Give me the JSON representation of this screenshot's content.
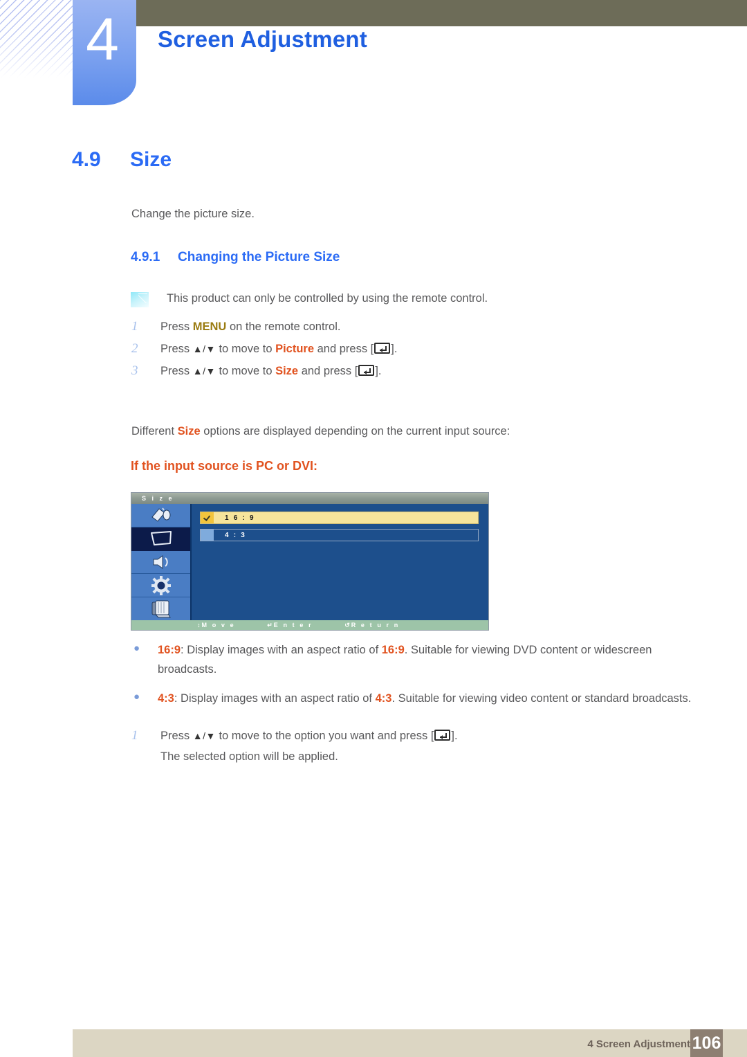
{
  "header": {
    "chapter_number": "4",
    "chapter_title": "Screen Adjustment"
  },
  "section": {
    "number": "4.9",
    "title": "Size",
    "intro": "Change the picture size."
  },
  "subsection": {
    "number": "4.9.1",
    "title": "Changing the Picture Size",
    "note": "This product can only be controlled by using the remote control.",
    "note_icon": "note-icon"
  },
  "steps": [
    {
      "n": "1",
      "pre": "Press ",
      "kw": "MENU",
      "kw_style": "gold",
      "post": " on the remote control.",
      "has_key": false
    },
    {
      "n": "2",
      "pre": "Press ",
      "arrows": "▲/▼",
      "mid": " to move to ",
      "kw": "Picture",
      "kw_style": "orange",
      "post": " and press [",
      "has_key": true,
      "tail": "]."
    },
    {
      "n": "3",
      "pre": "Press ",
      "arrows": "▲/▼",
      "mid": " to move to ",
      "kw": "Size",
      "kw_style": "orange",
      "post": " and press [",
      "has_key": true,
      "tail": "]."
    }
  ],
  "different_line": {
    "pre": "Different ",
    "kw": "Size",
    "post": " options are displayed depending on the current input source:"
  },
  "input_source_heading": "If the input source is PC or DVI:",
  "osd": {
    "title": "S i z e",
    "sidebar_icons": [
      {
        "name": "input-source-icon",
        "selected": false
      },
      {
        "name": "picture-screen-icon",
        "selected": true
      },
      {
        "name": "sound-speaker-icon",
        "selected": false
      },
      {
        "name": "setup-gear-icon",
        "selected": false
      },
      {
        "name": "multi-control-icon",
        "selected": false
      }
    ],
    "options": [
      {
        "label": "1 6 : 9",
        "selected": true
      },
      {
        "label": "4 : 3",
        "selected": false
      }
    ],
    "footer": [
      {
        "glyph": "↕",
        "label": "M o v e"
      },
      {
        "glyph": "↵",
        "label": "E n t e r"
      },
      {
        "glyph": "↺",
        "label": "R e t u r n"
      }
    ],
    "colors": {
      "background": "#1d4f8c",
      "highlight": "#f6e49b",
      "checkbox_on": "#f2c43c",
      "checkbox_off": "#7fabdc",
      "sidebar": "#4a7dc4",
      "sidebar_selected": "#0c1b4a",
      "title_bar": "#8d9a92",
      "footer_bar": "#9dc4a8"
    }
  },
  "bullets": [
    {
      "kw1": "16:9",
      "mid1": ": Display images with an aspect ratio of ",
      "kw2": "16:9",
      "rest": ". Suitable for viewing DVD content or widescreen broadcasts."
    },
    {
      "kw1": "4:3",
      "mid1": ": Display images with an aspect ratio of ",
      "kw2": "4:3",
      "rest": ". Suitable for viewing video content or standard broadcasts."
    }
  ],
  "final_step": {
    "n": "1",
    "pre": "Press ",
    "arrows": "▲/▼",
    "post": " to move to the option you want and press [",
    "tail": "].",
    "sub": "The selected option will be applied."
  },
  "footer": {
    "label": "4 Screen Adjustment",
    "page": "106"
  },
  "colors": {
    "accent_blue": "#2b6bf5",
    "accent_orange": "#e1521f",
    "accent_gold": "#9a7b10",
    "header_bar": "#6d6c58",
    "footer_bar": "#dcd6c3",
    "page_box": "#8d7f72",
    "body_text": "#58585a"
  }
}
